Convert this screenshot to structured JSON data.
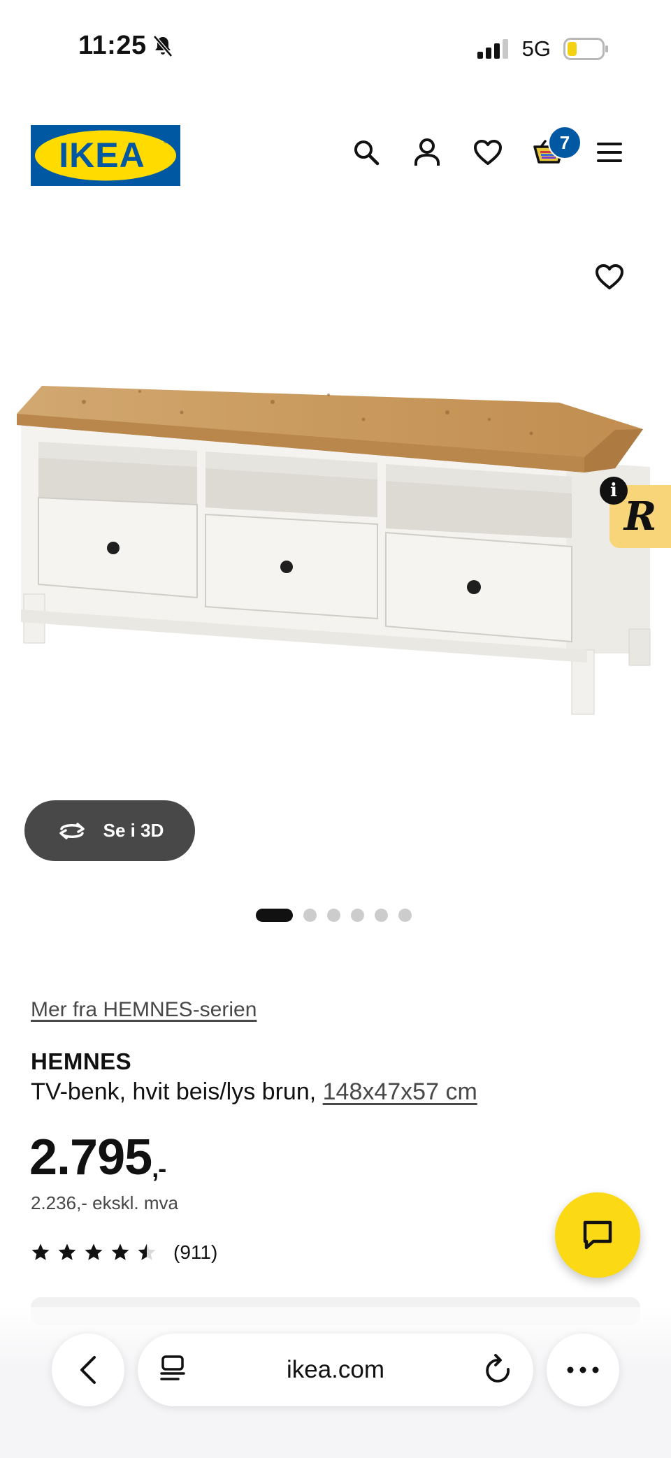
{
  "status_bar": {
    "time": "11:25",
    "network": "5G",
    "icons": [
      "silent-bell-icon",
      "signal-icon",
      "battery-icon"
    ]
  },
  "header": {
    "logo_text": "IKEA",
    "icons": [
      "search-icon",
      "user-icon",
      "heart-icon",
      "cart-icon",
      "menu-icon"
    ],
    "cart_count": "7",
    "colors": {
      "ikea_blue": "#0058a3",
      "ikea_yellow": "#ffdb00"
    }
  },
  "gallery": {
    "view_3d_label": "Se i 3D",
    "image_count": 6,
    "active_index": 0
  },
  "product": {
    "series_link": "Mer fra HEMNES-serien",
    "name": "HEMNES",
    "description": "TV-benk, hvit beis/lys brun, ",
    "dimensions": "148x47x57 cm",
    "price_main": "2.795",
    "price_suffix": ",-",
    "price_ex_vat": "2.236,- ekskl. mva",
    "rating_value": 4.5,
    "rating_count": "(911)"
  },
  "chat": {
    "color": "#fbd914"
  },
  "browser": {
    "url": "ikea.com"
  }
}
